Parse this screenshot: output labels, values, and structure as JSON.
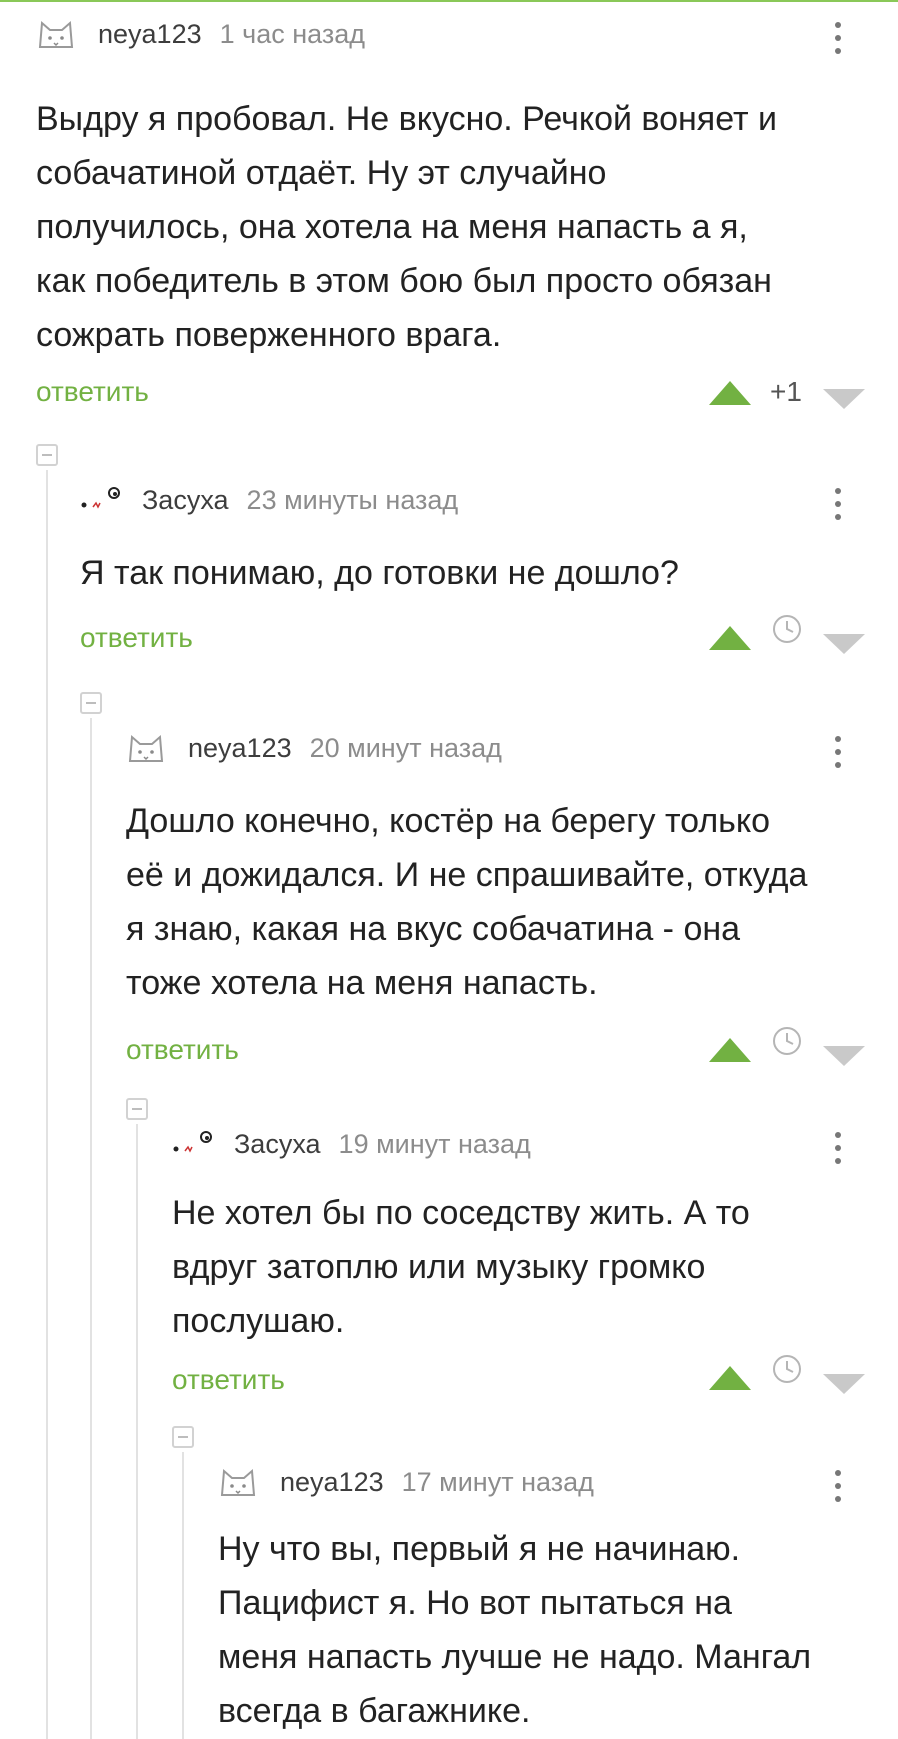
{
  "comments": [
    {
      "username": "neya123",
      "time": "1 час назад",
      "avatar": "cat-avatar",
      "lines": [
        "Выдру я пробовал. Не вкусно. Речкой воняет и",
        "собачатиной отдаёт. Ну эт случайно",
        "получилось, она хотела на меня напасть а я,",
        "как победитель в этом бою был просто обязан",
        "сожрать поверженного врага."
      ],
      "reply_label": "ответить",
      "score": "+1"
    },
    {
      "username": "Засуха",
      "time": "23 минуты назад",
      "avatar": "face-avatar",
      "lines": [
        "Я так понимаю, до готовки не дошло?"
      ],
      "reply_label": "ответить"
    },
    {
      "username": "neya123",
      "time": "20 минут назад",
      "avatar": "cat-avatar",
      "lines": [
        "Дошло конечно, костёр на берегу только",
        "её и дожидался. И не спрашивайте, откуда",
        "я знаю, какая на вкус собачатина - она",
        "тоже хотела на меня напасть."
      ],
      "reply_label": "ответить"
    },
    {
      "username": "Засуха",
      "time": "19 минут назад",
      "avatar": "face-avatar",
      "lines": [
        "Не хотел бы по соседству жить. А то",
        "вдруг затоплю или музыку громко",
        "послушаю."
      ],
      "reply_label": "ответить"
    },
    {
      "username": "neya123",
      "time": "17 минут назад",
      "avatar": "cat-avatar",
      "lines": [
        "Ну что вы, первый я не начинаю.",
        "Пацифист я. Но вот пытаться на",
        "меня напасть лучше не надо. Мангал",
        "всегда в багажнике."
      ]
    }
  ],
  "colors": {
    "accent": "#72b142",
    "username": "#3d3d3d",
    "time": "#8c8c8c",
    "text": "#222222",
    "downvote": "#c9c9c9"
  },
  "icons": {
    "upvote": "triangle-up-icon",
    "downvote": "triangle-down-icon",
    "timer": "clock-icon",
    "menu": "more-vertical-icon",
    "collapse": "collapse-minus-icon"
  }
}
